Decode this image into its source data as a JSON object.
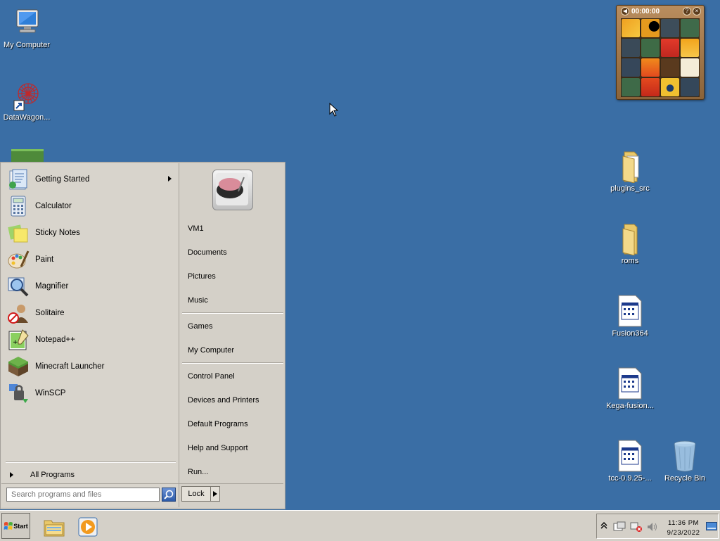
{
  "desktop": {
    "icons": [
      {
        "label": "My Computer",
        "icon": "computer-icon"
      },
      {
        "label": "DataWagon...",
        "icon": "datawagon-icon"
      },
      {
        "label": "plugins_src",
        "icon": "folder-icon"
      },
      {
        "label": "roms",
        "icon": "folder-icon"
      },
      {
        "label": "Fusion364",
        "icon": "program-file-icon"
      },
      {
        "label": "Kega-fusion...",
        "icon": "program-file-icon"
      },
      {
        "label": "tcc-0.9.25-...",
        "icon": "program-file-icon"
      },
      {
        "label": "Recycle Bin",
        "icon": "recycle-bin-icon"
      }
    ]
  },
  "puzzle_gadget": {
    "timer": "00:00:00",
    "help_label": "?",
    "close_label": "×"
  },
  "start_menu": {
    "programs": [
      {
        "label": "Getting Started",
        "icon": "getting-started-icon",
        "has_submenu": true
      },
      {
        "label": "Calculator",
        "icon": "calculator-icon"
      },
      {
        "label": "Sticky Notes",
        "icon": "sticky-notes-icon"
      },
      {
        "label": "Paint",
        "icon": "paint-icon"
      },
      {
        "label": "Magnifier",
        "icon": "magnifier-icon"
      },
      {
        "label": "Solitaire",
        "icon": "solitaire-icon"
      },
      {
        "label": "Notepad++",
        "icon": "notepad-plus-icon"
      },
      {
        "label": "Minecraft Launcher",
        "icon": "minecraft-icon"
      },
      {
        "label": "WinSCP",
        "icon": "winscp-icon"
      }
    ],
    "all_programs": "All Programs",
    "search_placeholder": "Search programs and files",
    "right_links_group1": [
      "VM1",
      "Documents",
      "Pictures",
      "Music"
    ],
    "right_links_group2": [
      "Games",
      "My Computer"
    ],
    "right_links_group3": [
      "Control Panel",
      "Devices and Printers",
      "Default Programs",
      "Help and Support",
      "Run..."
    ],
    "lock_label": "Lock"
  },
  "taskbar": {
    "start_label": "Start",
    "pinned": [
      {
        "icon": "file-explorer-icon"
      },
      {
        "icon": "media-player-icon"
      }
    ],
    "clock": {
      "time": "11:36 PM",
      "date": "9/23/2022"
    }
  },
  "colors": {
    "desktop": "#3a6ea5",
    "menu": "#d4d0c8",
    "accent": "#2c5aa8"
  }
}
